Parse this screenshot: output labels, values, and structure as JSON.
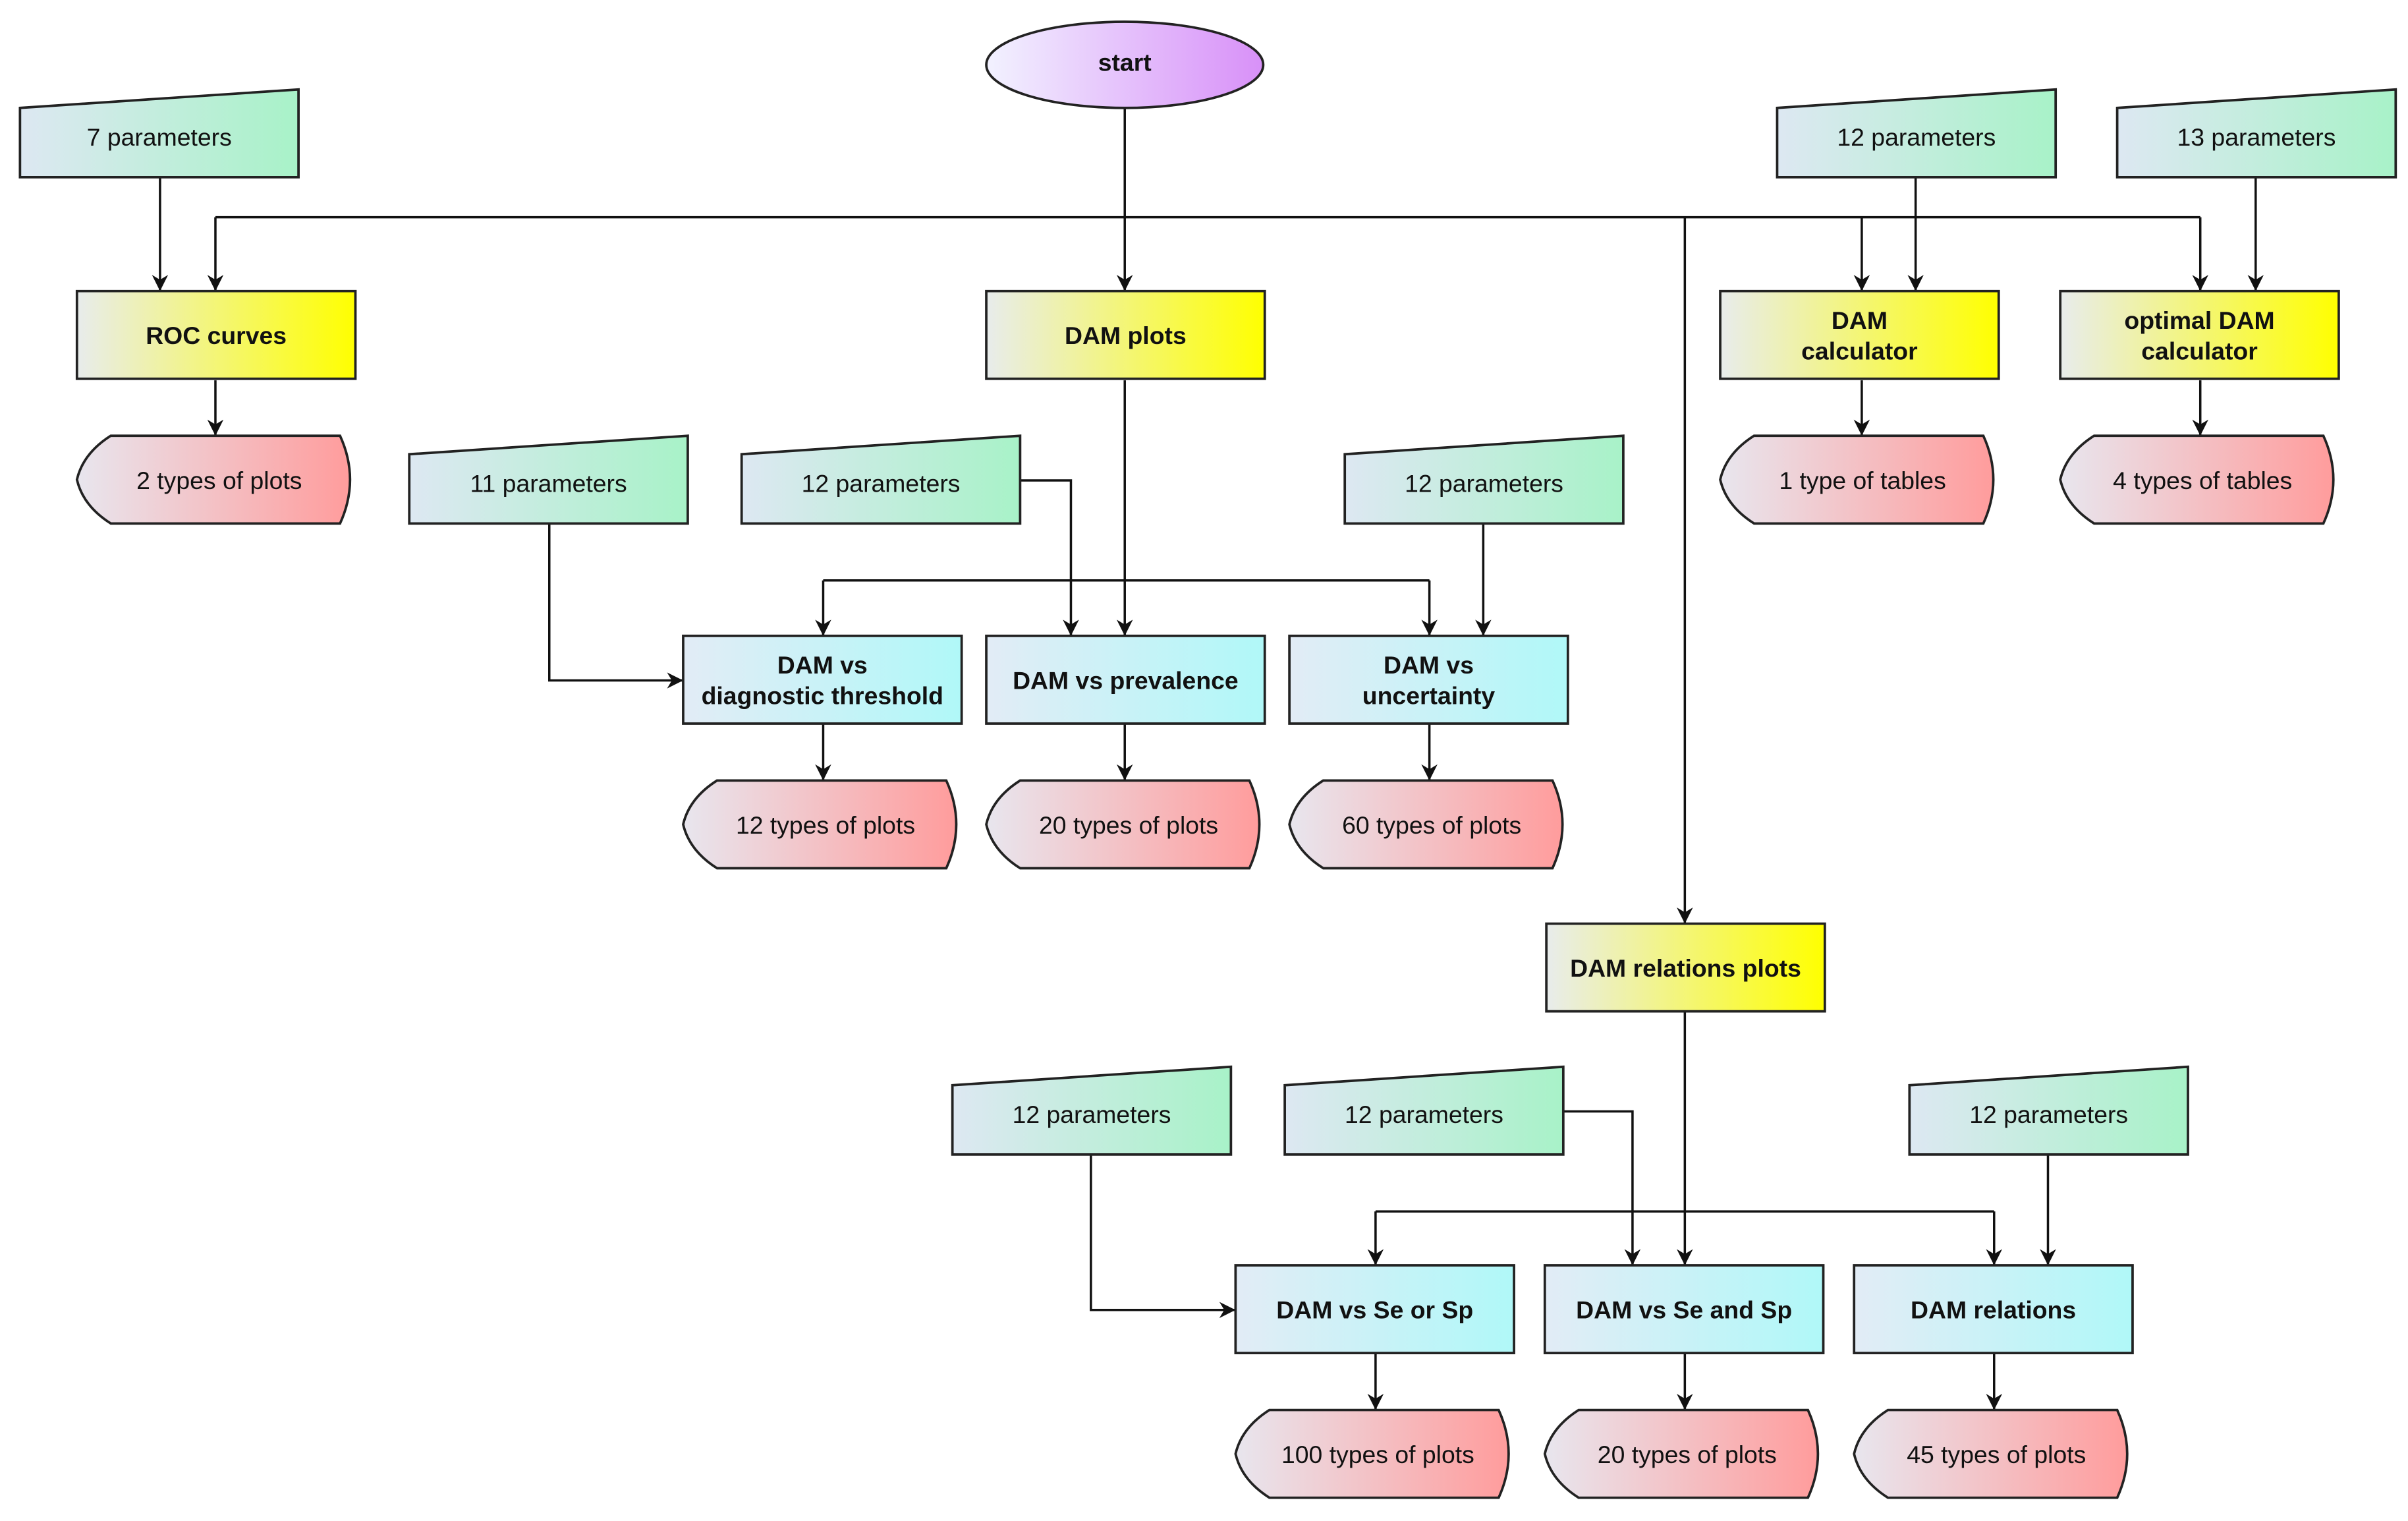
{
  "start": {
    "label": [
      "start"
    ]
  },
  "parameters": [
    {
      "id": "p7",
      "label": [
        "7 parameters"
      ]
    },
    {
      "id": "p12a",
      "label": [
        "12 parameters"
      ]
    },
    {
      "id": "p13",
      "label": [
        "13 parameters"
      ]
    },
    {
      "id": "p11",
      "label": [
        "11 parameters"
      ]
    },
    {
      "id": "p12b",
      "label": [
        "12 parameters"
      ]
    },
    {
      "id": "p12c",
      "label": [
        "12 parameters"
      ]
    },
    {
      "id": "p12d",
      "label": [
        "12 parameters"
      ]
    },
    {
      "id": "p12e",
      "label": [
        "12 parameters"
      ]
    },
    {
      "id": "p12f",
      "label": [
        "12 parameters"
      ]
    }
  ],
  "modules": [
    {
      "id": "roc",
      "label": [
        "ROC curves"
      ]
    },
    {
      "id": "damplots",
      "label": [
        "DAM plots"
      ]
    },
    {
      "id": "damcalc",
      "label": [
        "DAM",
        "calculator"
      ]
    },
    {
      "id": "optcalc",
      "label": [
        "optimal DAM",
        "calculator"
      ]
    },
    {
      "id": "relplots",
      "label": [
        "DAM relations plots"
      ]
    }
  ],
  "submodules": [
    {
      "id": "thresh",
      "label": [
        "DAM vs",
        "diagnostic threshold"
      ]
    },
    {
      "id": "prev",
      "label": [
        "DAM vs prevalence"
      ]
    },
    {
      "id": "unc",
      "label": [
        "DAM vs",
        "uncertainty"
      ]
    },
    {
      "id": "seorsp",
      "label": [
        "DAM vs Se or Sp"
      ]
    },
    {
      "id": "seandsp",
      "label": [
        "DAM vs Se and Sp"
      ]
    },
    {
      "id": "rel",
      "label": [
        "DAM relations"
      ]
    }
  ],
  "outputs": [
    {
      "id": "o2",
      "label": [
        "2 types of plots"
      ]
    },
    {
      "id": "o1t",
      "label": [
        "1 type of tables"
      ]
    },
    {
      "id": "o4t",
      "label": [
        "4 types of tables"
      ]
    },
    {
      "id": "o12",
      "label": [
        "12 types of plots"
      ]
    },
    {
      "id": "o20",
      "label": [
        "20 types of plots"
      ]
    },
    {
      "id": "o60",
      "label": [
        "60 types of plots"
      ]
    },
    {
      "id": "o100",
      "label": [
        "100 types of plots"
      ]
    },
    {
      "id": "o20b",
      "label": [
        "20 types of plots"
      ]
    },
    {
      "id": "o45",
      "label": [
        "45 types of plots"
      ]
    }
  ],
  "colors": {
    "parameters": [
      "#dde8f2",
      "#a8f2c8"
    ],
    "modules": [
      "#e8ecec",
      "#ffff00"
    ],
    "submodules": [
      "#e2ecf6",
      "#b0f8f8"
    ],
    "outputs": [
      "#e8e6ee",
      "#ff9c9c"
    ],
    "start": [
      "#f2f2ff",
      "#d890f8"
    ]
  }
}
